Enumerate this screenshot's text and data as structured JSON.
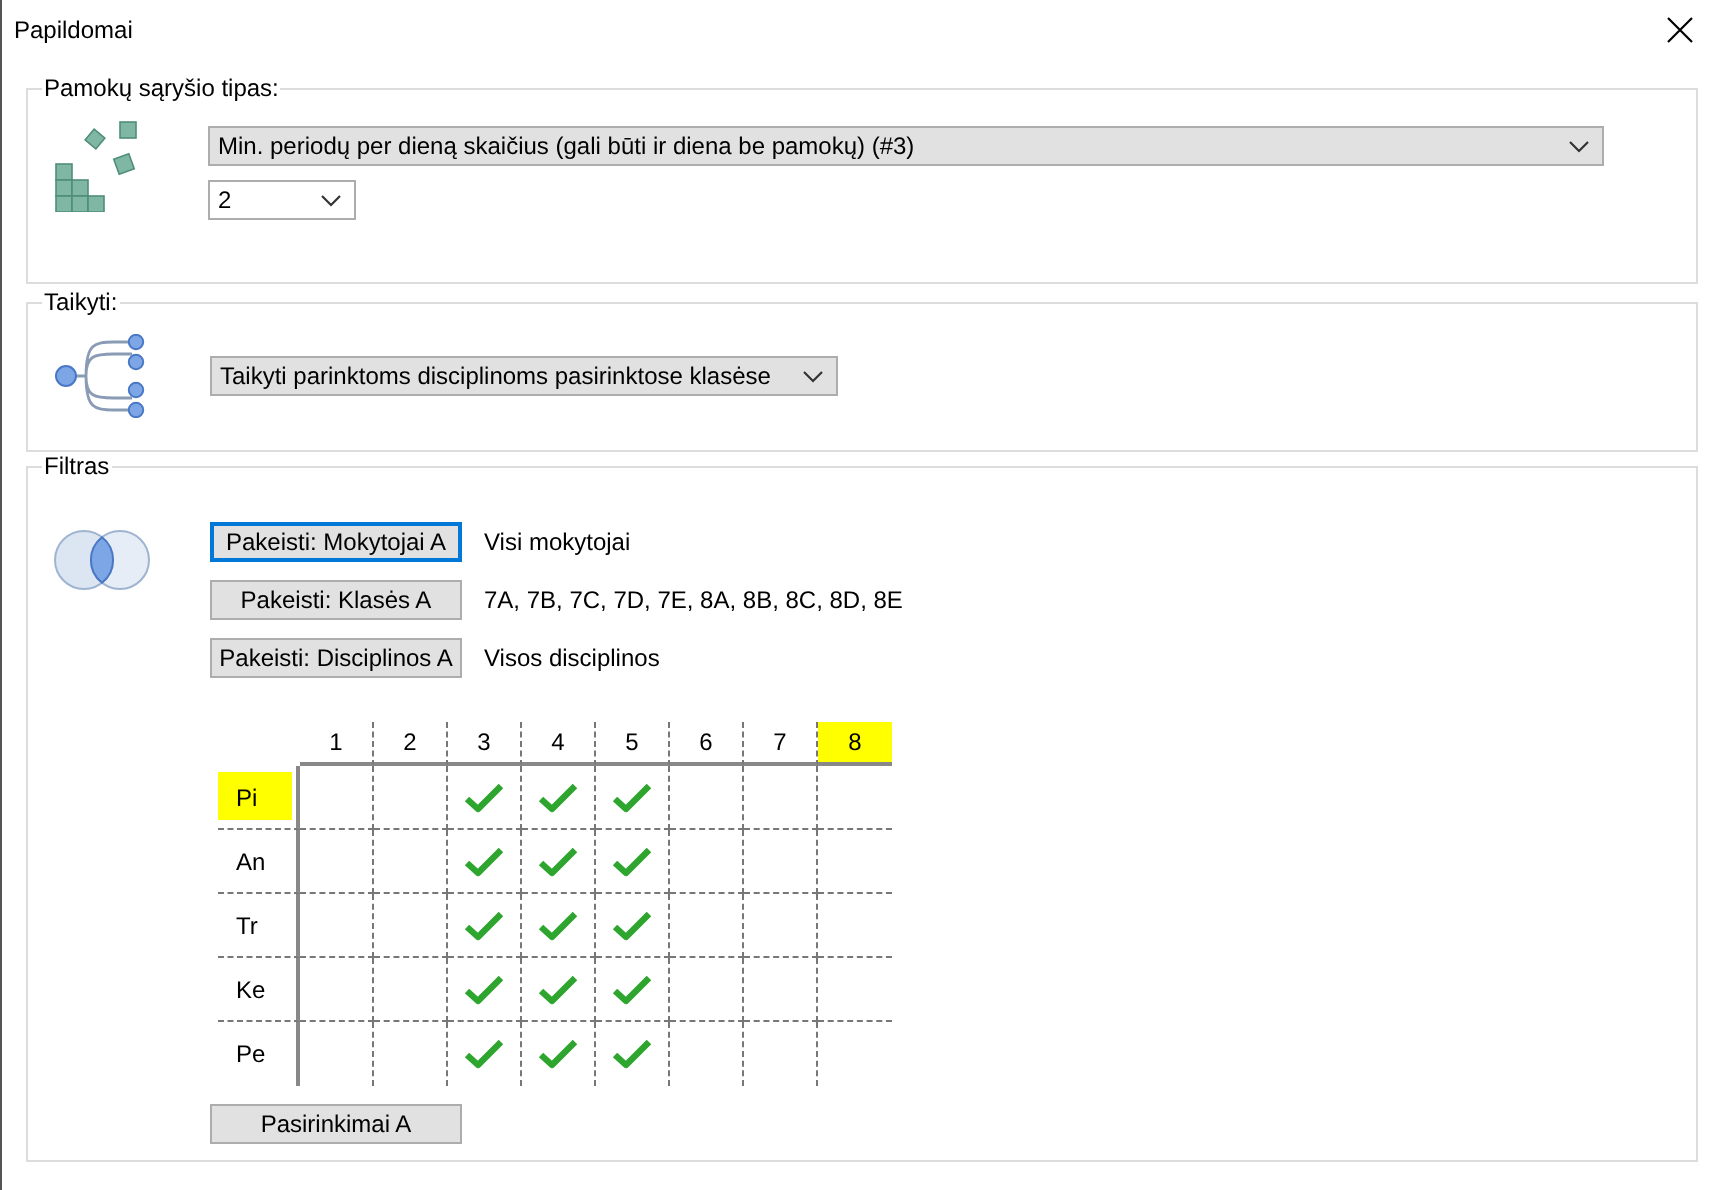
{
  "window": {
    "title": "Papildomai"
  },
  "constraint_type": {
    "legend": "Pamokų sąryšio tipas:",
    "type_value": "Min. periodų per dieną skaičius (gali būti ir diena be pamokų) (#3)",
    "count_value": "2"
  },
  "apply_to": {
    "legend": "Taikyti:",
    "value": "Taikyti parinktoms disciplinoms pasirinktose klasėse"
  },
  "filter": {
    "legend": "Filtras",
    "rows": [
      {
        "button": "Pakeisti: Mokytojai A",
        "focused": true,
        "summary": "Visi mokytojai"
      },
      {
        "button": "Pakeisti: Klasės A",
        "focused": false,
        "summary": "7A, 7B, 7C, 7D, 7E, 8A, 8B, 8C, 8D, 8E"
      },
      {
        "button": "Pakeisti: Disciplinos A",
        "focused": false,
        "summary": "Visos disciplinos"
      }
    ],
    "grid": {
      "columns": [
        {
          "label": "1",
          "highlighted": false
        },
        {
          "label": "2",
          "highlighted": false
        },
        {
          "label": "3",
          "highlighted": false
        },
        {
          "label": "4",
          "highlighted": false
        },
        {
          "label": "5",
          "highlighted": false
        },
        {
          "label": "6",
          "highlighted": false
        },
        {
          "label": "7",
          "highlighted": false
        },
        {
          "label": "8",
          "highlighted": true
        }
      ],
      "rows": [
        {
          "label": "Pi",
          "highlighted": true,
          "cells": [
            false,
            false,
            true,
            true,
            true,
            false,
            false,
            false
          ]
        },
        {
          "label": "An",
          "highlighted": false,
          "cells": [
            false,
            false,
            true,
            true,
            true,
            false,
            false,
            false
          ]
        },
        {
          "label": "Tr",
          "highlighted": false,
          "cells": [
            false,
            false,
            true,
            true,
            true,
            false,
            false,
            false
          ]
        },
        {
          "label": "Ke",
          "highlighted": false,
          "cells": [
            false,
            false,
            true,
            true,
            true,
            false,
            false,
            false
          ]
        },
        {
          "label": "Pe",
          "highlighted": false,
          "cells": [
            false,
            false,
            true,
            true,
            true,
            false,
            false,
            false
          ]
        }
      ]
    },
    "choices_button": "Pasirinkimai A"
  }
}
